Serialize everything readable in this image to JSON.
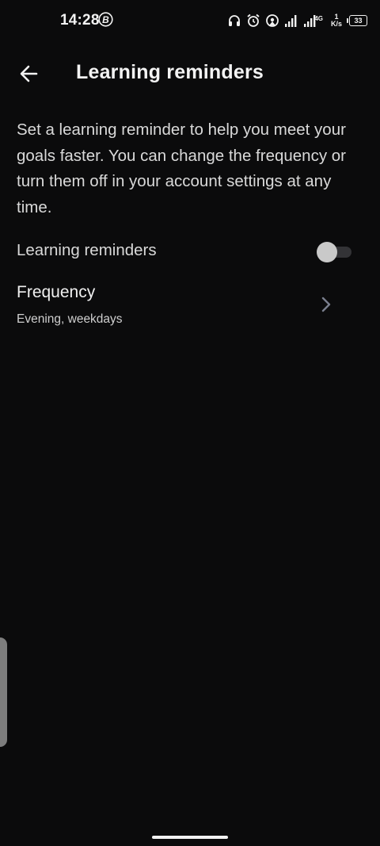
{
  "status_bar": {
    "time": "14:28",
    "network_type": "4G",
    "speed_value": "1",
    "speed_unit": "K/s",
    "battery": "33"
  },
  "app_bar": {
    "title": "Learning reminders"
  },
  "description": "Set a learning reminder to help you meet your goals faster. You can change the frequency or turn them off in your account settings at any time.",
  "reminder_toggle": {
    "label": "Learning reminders",
    "enabled": false
  },
  "frequency": {
    "title": "Frequency",
    "value": "Evening, weekdays"
  },
  "colors": {
    "background": "#0b0b0c",
    "text": "#e6e6e6",
    "toggle_off_knob": "#c9c9c9",
    "chevron": "#7a7f8e"
  }
}
